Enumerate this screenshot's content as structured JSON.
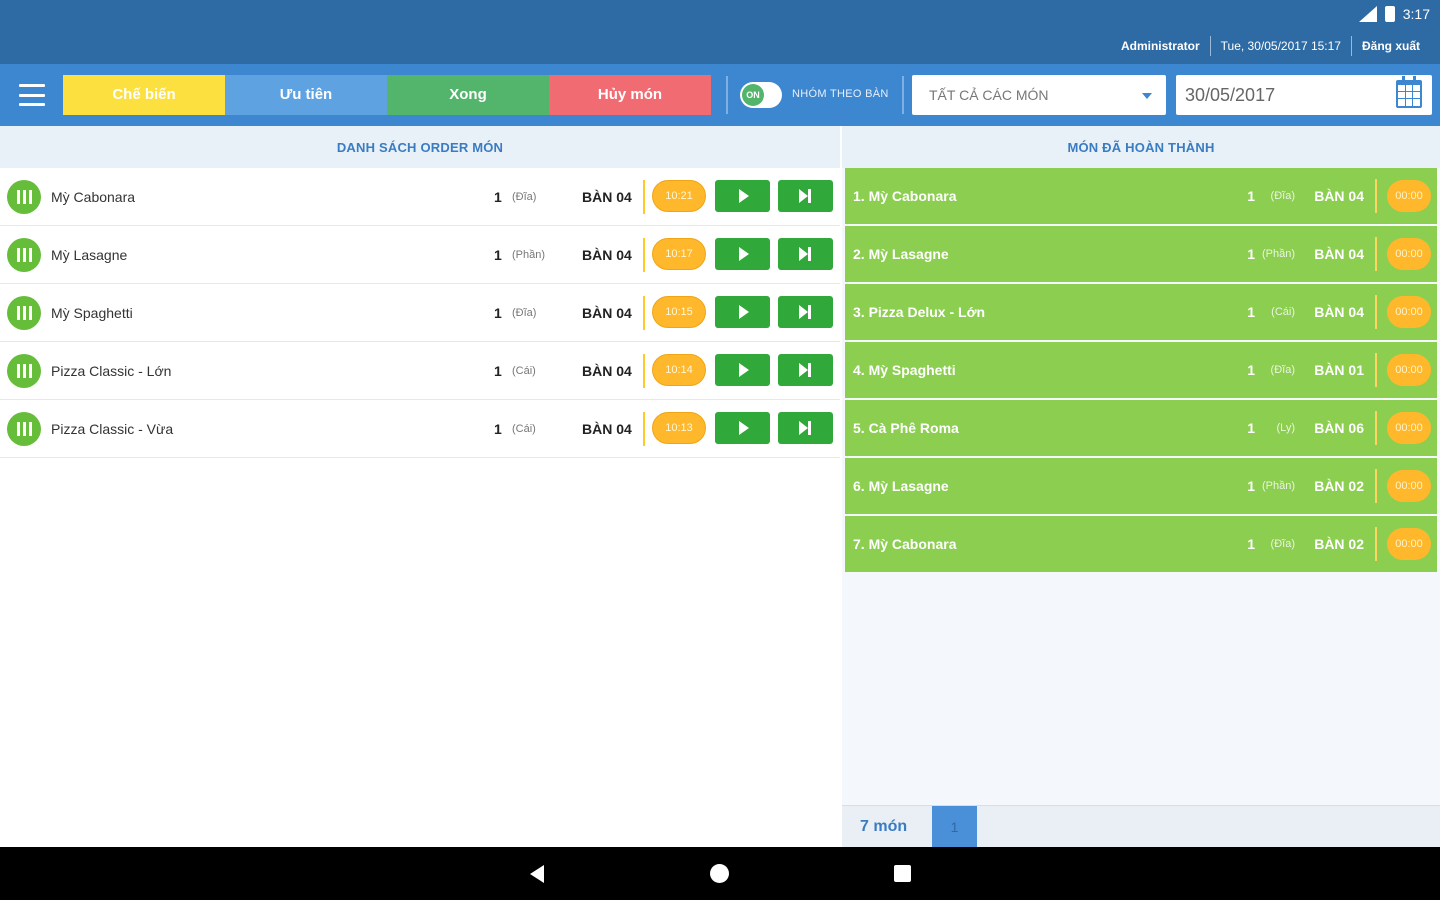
{
  "status_bar": {
    "time": "3:17"
  },
  "header": {
    "user": "Administrator",
    "datetime": "Tue, 30/05/2017 15:17",
    "logout": "Đăng xuất"
  },
  "toolbar": {
    "tabs": [
      {
        "label": "Chế biến",
        "color": "#fce040"
      },
      {
        "label": "Ưu tiên",
        "color": "#5fa2e2"
      },
      {
        "label": "Xong",
        "color": "#53b56b"
      },
      {
        "label": "Hủy món",
        "color": "#f06b72"
      }
    ],
    "toggle_text": "ON",
    "group_label": "NHÓM THEO BÀN",
    "filter_selected": "TẤT CẢ CÁC MÓN",
    "date_value": "30/05/2017"
  },
  "orders": {
    "header": "DANH SÁCH ORDER MÓN",
    "rows": [
      {
        "name": "Mỳ Cabonara",
        "qty": "1",
        "unit": "(Đĩa)",
        "table": "BÀN 04",
        "timer": "10:21"
      },
      {
        "name": "Mỳ Lasagne",
        "qty": "1",
        "unit": "(Phần)",
        "table": "BÀN 04",
        "timer": "10:17"
      },
      {
        "name": "Mỳ Spaghetti",
        "qty": "1",
        "unit": "(Đĩa)",
        "table": "BÀN 04",
        "timer": "10:15"
      },
      {
        "name": "Pizza Classic - Lớn",
        "qty": "1",
        "unit": "(Cái)",
        "table": "BÀN 04",
        "timer": "10:14"
      },
      {
        "name": "Pizza Classic - Vừa",
        "qty": "1",
        "unit": "(Cái)",
        "table": "BÀN 04",
        "timer": "10:13"
      }
    ]
  },
  "completed": {
    "header": "MÓN ĐÃ HOÀN THÀNH",
    "rows": [
      {
        "name": "1. Mỳ Cabonara",
        "qty": "1",
        "unit": "(Đĩa)",
        "table": "BÀN 04",
        "timer": "00:00"
      },
      {
        "name": "2. Mỳ Lasagne",
        "qty": "1",
        "unit": "(Phần)",
        "table": "BÀN 04",
        "timer": "00:00"
      },
      {
        "name": "3. Pizza Delux - Lớn",
        "qty": "1",
        "unit": "(Cái)",
        "table": "BÀN 04",
        "timer": "00:00"
      },
      {
        "name": "4. Mỳ Spaghetti",
        "qty": "1",
        "unit": "(Đĩa)",
        "table": "BÀN 01",
        "timer": "00:00"
      },
      {
        "name": "5. Cà Phê Roma",
        "qty": "1",
        "unit": "(Ly)",
        "table": "BÀN 06",
        "timer": "00:00"
      },
      {
        "name": "6. Mỳ Lasagne",
        "qty": "1",
        "unit": "(Phần)",
        "table": "BÀN 02",
        "timer": "00:00"
      },
      {
        "name": "7. Mỳ Cabonara",
        "qty": "1",
        "unit": "(Đĩa)",
        "table": "BÀN 02",
        "timer": "00:00"
      }
    ],
    "count": "7 món",
    "page": "1"
  },
  "colors": {
    "header_bg": "#2e6aa3",
    "toolbar_bg": "#3d86d0",
    "done_row": "#8cce4f",
    "action_green": "#31a83a",
    "timer": "#ffb72b"
  }
}
